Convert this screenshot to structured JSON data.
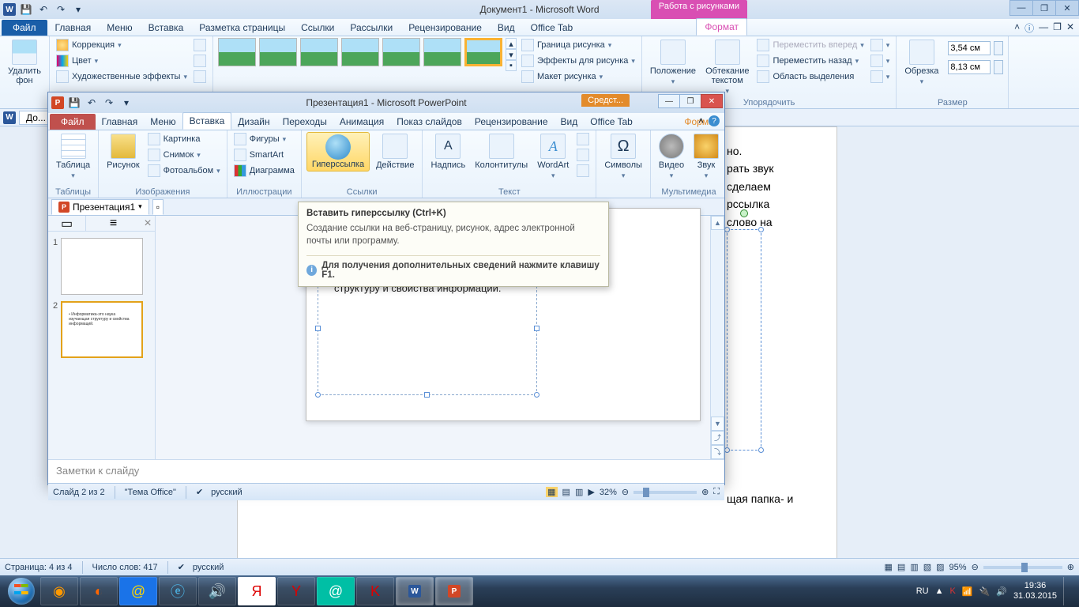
{
  "word": {
    "title": "Документ1  -  Microsoft Word",
    "contextual_tab": "Работа с рисунками",
    "tabs": [
      "Файл",
      "Главная",
      "Меню",
      "Вставка",
      "Разметка страницы",
      "Ссылки",
      "Рассылки",
      "Рецензирование",
      "Вид",
      "Office Tab"
    ],
    "format_tab": "Формат",
    "ribbon": {
      "remove_bg": "Удалить\nфон",
      "corrections": "Коррекция",
      "color": "Цвет",
      "art_effects": "Художественные эффекты",
      "border": "Граница рисунка",
      "effects": "Эффекты для рисунка",
      "layout": "Макет рисунка",
      "position": "Положение",
      "wrap": "Обтекание\nтекстом",
      "bring_fwd": "Переместить вперед",
      "send_back": "Переместить назад",
      "selection_pane": "Область выделения",
      "crop": "Обрезка",
      "h": "3,54 см",
      "w": "8,13 см",
      "grp_arrange": "Упорядочить",
      "grp_size": "Размер"
    },
    "doctab": "До...",
    "body_lines": [
      "но.",
      "рать звук",
      "сделаем",
      "рссылка",
      "слово на",
      "щая папка- и"
    ],
    "status": {
      "page": "Страница: 4 из 4",
      "words": "Число слов: 417",
      "lang": "русский",
      "zoom": "95%"
    }
  },
  "pp": {
    "title": "Презентация1 - Microsoft PowerPoint",
    "contextual": "Средст...",
    "tabs": [
      "Файл",
      "Главная",
      "Меню",
      "Вставка",
      "Дизайн",
      "Переходы",
      "Анимация",
      "Показ слайдов",
      "Рецензирование",
      "Вид",
      "Office Tab"
    ],
    "format_tab": "Формат",
    "ribbon": {
      "table": "Таблица",
      "picture": "Рисунок",
      "clipart": "Картинка",
      "screenshot": "Снимок",
      "album": "Фотоальбом",
      "shapes": "Фигуры",
      "smartart": "SmartArt",
      "chart": "Диаграмма",
      "hyperlink": "Гиперссылка",
      "action": "Действие",
      "textbox": "Надпись",
      "header_footer": "Колонтитулы",
      "wordart": "WordArt",
      "symbols": "Символы",
      "video": "Видео",
      "audio": "Звук",
      "grp_tables": "Таблицы",
      "grp_images": "Изображения",
      "grp_illust": "Иллюстрации",
      "grp_links": "Ссылки",
      "grp_text": "Текст",
      "grp_media": "Мультимедиа"
    },
    "doctab": "Презентация1",
    "slide_text_word": "Информатика",
    "slide_text_rest1": "- это наука изучающая",
    "slide_text_rest2": "структуру и свойства информаций.",
    "notes_placeholder": "Заметки к слайду",
    "status": {
      "slide": "Слайд 2 из 2",
      "theme": "\"Тема Office\"",
      "lang": "русский",
      "zoom": "32%"
    }
  },
  "tooltip": {
    "title": "Вставить гиперссылку (Ctrl+K)",
    "body": "Создание ссылки на веб-страницу, рисунок, адрес электронной почты или программу.",
    "foot": "Для получения дополнительных сведений нажмите клавишу F1."
  },
  "taskbar": {
    "lang": "RU",
    "time": "19:36",
    "date": "31.03.2015"
  }
}
